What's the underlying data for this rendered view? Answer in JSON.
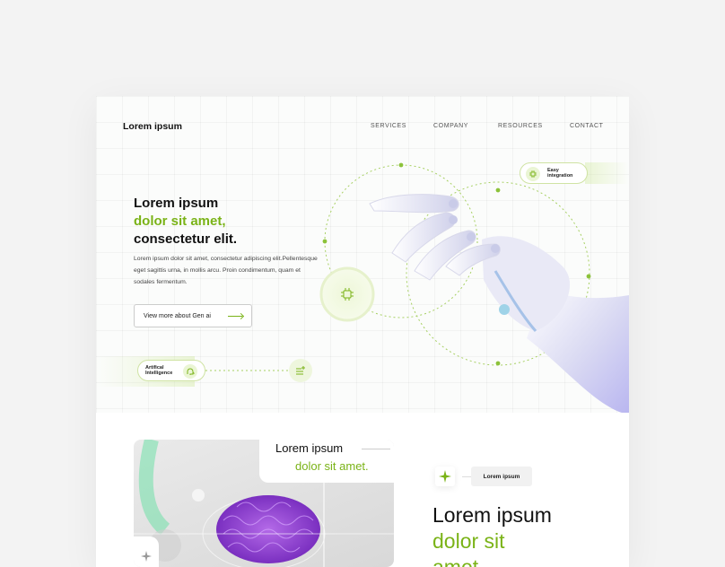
{
  "header": {
    "logo": "Lorem ipsum",
    "nav": [
      "SERVICES",
      "COMPANY",
      "RESOURCES",
      "CONTACT"
    ]
  },
  "hero": {
    "line1": "Lorem ipsum",
    "line2": "dolor sit amet,",
    "line3": "consectetur elit.",
    "description": "Lorem ipsum dolor sit amet, consectetur adipiscing elit.Pellentesque eget sagittis urna, in mollis arcu. Proin condimentum, quam et sodales fermentum.",
    "cta_label": "View more about Gen ai",
    "pill_ai_line1": "Artifical",
    "pill_ai_line2": "Intelligence",
    "pill_easy_line1": "Easy",
    "pill_easy_line2": "integration"
  },
  "section2": {
    "card_title": "Lorem ipsum",
    "card_sub": "dolor sit amet.",
    "tag": "Lorem ipsum",
    "title_line1": "Lorem ipsum",
    "title_line2": "dolor sit",
    "title_line3": "amet"
  },
  "colors": {
    "accent": "#7ab317",
    "text": "#111111"
  },
  "icons": [
    "chip-icon",
    "brain-head-icon",
    "list-plus-icon",
    "sparkle-icon",
    "arrow-right-icon"
  ]
}
